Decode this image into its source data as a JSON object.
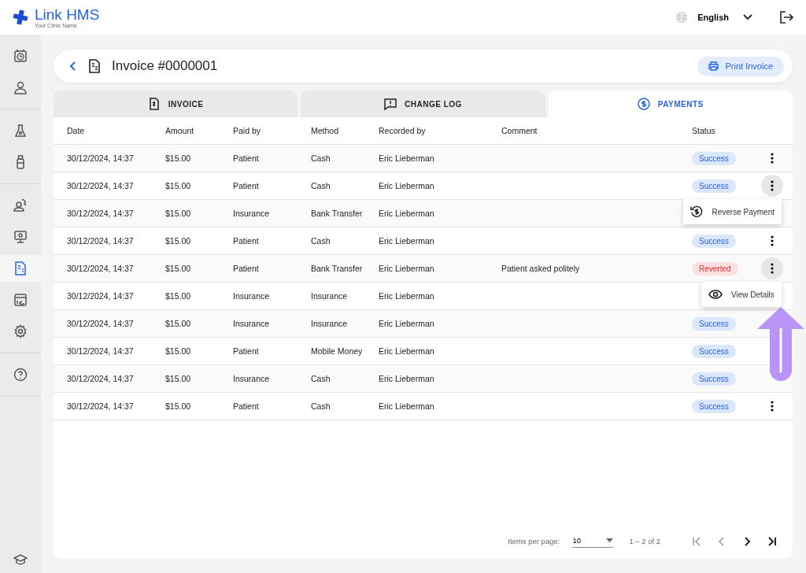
{
  "brand": {
    "name_part1": "Link",
    "name_part2": "HMS",
    "tagline": "Your Clinic Name"
  },
  "language": {
    "label": "English"
  },
  "sidebar": {
    "groups": [
      [
        {
          "kind": "calendar",
          "selected": false
        },
        {
          "kind": "person",
          "selected": false
        }
      ],
      [
        {
          "kind": "flask",
          "selected": false
        },
        {
          "kind": "bottle",
          "selected": false
        }
      ],
      [
        {
          "kind": "people",
          "selected": false
        },
        {
          "kind": "monitor",
          "selected": false
        },
        {
          "kind": "invoice",
          "selected": true
        },
        {
          "kind": "report",
          "selected": false
        },
        {
          "kind": "settings",
          "selected": false
        }
      ],
      [
        {
          "kind": "help",
          "selected": false
        }
      ]
    ]
  },
  "header": {
    "title": "Invoice #0000001",
    "print_button": "Print Invoice"
  },
  "tabs": [
    {
      "label": "INVOICE",
      "selected": false
    },
    {
      "label": "CHANGE LOG",
      "selected": false
    },
    {
      "label": "PAYMENTS",
      "selected": true
    }
  ],
  "table": {
    "columns": [
      "Date",
      "Amount",
      "Paid by",
      "Method",
      "Recorded by",
      "Comment",
      "Status"
    ],
    "rows": [
      {
        "date": "30/12/2024, 14:37",
        "amount": "$15.00",
        "paid_by": "Patient",
        "method": "Cash",
        "recorded_by": "Eric Lieberman",
        "status": "Success",
        "kind": "success",
        "actions": true
      },
      {
        "date": "30/12/2024, 14:37",
        "amount": "$15.00",
        "paid_by": "Patient",
        "method": "Cash",
        "recorded_by": "Eric Lieberman",
        "status": "Success",
        "kind": "success",
        "actions": true,
        "menu": {
          "kind": "reverse",
          "label": "Reverse Payment"
        }
      },
      {
        "date": "30/12/2024, 14:37",
        "amount": "$15.00",
        "paid_by": "Insurance",
        "method": "Bank Transfer",
        "recorded_by": "Eric Lieberman",
        "actions": false
      },
      {
        "date": "30/12/2024, 14:37",
        "amount": "$15.00",
        "paid_by": "Patient",
        "method": "Cash",
        "recorded_by": "Eric Lieberman",
        "status": "Success",
        "kind": "success",
        "actions": true
      },
      {
        "date": "30/12/2024, 14:37",
        "amount": "$15.00",
        "paid_by": "Patient",
        "method": "Bank Transfer",
        "recorded_by": "Eric Lieberman",
        "comment": "Patient asked politely",
        "status": "Reverted",
        "kind": "reverted",
        "actions": true,
        "menu": {
          "kind": "view",
          "label": "View Details"
        }
      },
      {
        "date": "30/12/2024, 14:37",
        "amount": "$15.00",
        "paid_by": "Insurance",
        "method": "Insurance",
        "recorded_by": "Eric Lieberman",
        "actions": false
      },
      {
        "date": "30/12/2024, 14:37",
        "amount": "$15.00",
        "paid_by": "Insurance",
        "method": "Insurance",
        "recorded_by": "Eric Lieberman",
        "status": "Success",
        "kind": "success",
        "actions": false
      },
      {
        "date": "30/12/2024, 14:37",
        "amount": "$15.00",
        "paid_by": "Patient",
        "method": "Mobile Money",
        "recorded_by": "Eric Lieberman",
        "status": "Success",
        "kind": "success",
        "actions": false
      },
      {
        "date": "30/12/2024, 14:37",
        "amount": "$15.00",
        "paid_by": "Insurance",
        "method": "Cash",
        "recorded_by": "Eric Lieberman",
        "status": "Success",
        "kind": "success",
        "actions": false
      },
      {
        "date": "30/12/2024, 14:37",
        "amount": "$15.00",
        "paid_by": "Patient",
        "method": "Cash",
        "recorded_by": "Eric Lieberman",
        "status": "Success",
        "kind": "success",
        "actions": true
      }
    ]
  },
  "pagination": {
    "items_label": "Items per page:",
    "page_size": "10",
    "range": "1 – 2 of 2"
  }
}
